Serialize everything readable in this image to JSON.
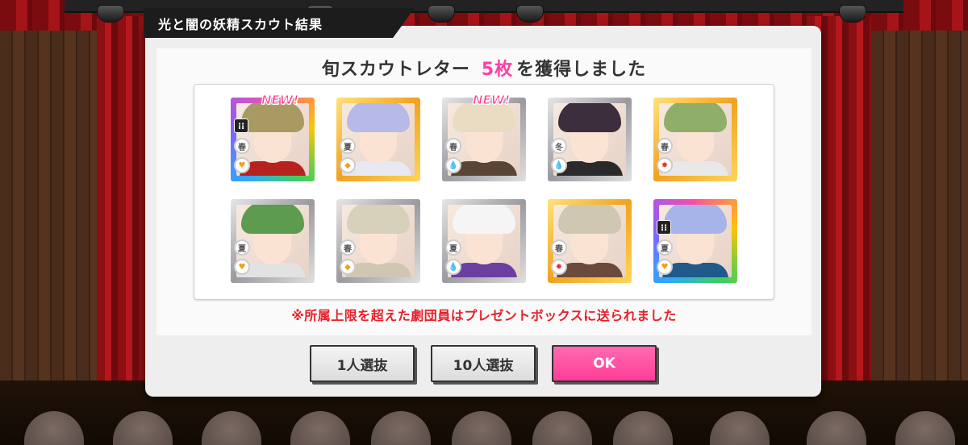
{
  "header": {
    "title": "光と闇の妖精スカウト結果"
  },
  "result": {
    "headline_pre": "旬スカウトレター",
    "count": "5枚",
    "headline_post": "を獲得しました",
    "accent": "#ff3da8"
  },
  "cards": [
    {
      "frame": "rainbow",
      "season": "春",
      "type": "♥",
      "rare": "⁝⁝",
      "new": "NEW!",
      "hair": "#a89a62",
      "body": "#b8221e"
    },
    {
      "frame": "gold",
      "season": "夏",
      "type": "◆",
      "rare": "",
      "new": "",
      "hair": "#b7b9e8",
      "body": "#e8e8f2"
    },
    {
      "frame": "silver",
      "season": "春",
      "type": "💧",
      "rare": "",
      "new": "NEW!",
      "hair": "#e9dcc2",
      "body": "#5a4436"
    },
    {
      "frame": "silver",
      "season": "冬",
      "type": "💧",
      "rare": "",
      "new": "",
      "hair": "#3c2e3c",
      "body": "#2a2a2a"
    },
    {
      "frame": "gold",
      "season": "春",
      "type": "✸",
      "rare": "",
      "new": "",
      "hair": "#8fae6a",
      "body": "#e8e8e8"
    },
    {
      "frame": "silver",
      "season": "夏",
      "type": "♥",
      "rare": "",
      "new": "",
      "hair": "#5d9b4f",
      "body": "#e2e2e2"
    },
    {
      "frame": "silver",
      "season": "春",
      "type": "◆",
      "rare": "",
      "new": "",
      "hair": "#d7d1bb",
      "body": "#cfc7b2"
    },
    {
      "frame": "silver",
      "season": "夏",
      "type": "💧",
      "rare": "",
      "new": "",
      "hair": "#f5f5f5",
      "body": "#6b3fa0"
    },
    {
      "frame": "gold",
      "season": "春",
      "type": "✸",
      "rare": "",
      "new": "",
      "hair": "#cfc7b2",
      "body": "#6a4a3a"
    },
    {
      "frame": "rainbow",
      "season": "夏",
      "type": "♥",
      "rare": "⁝⁝",
      "new": "",
      "hair": "#a7b4ea",
      "body": "#1f5a8a"
    }
  ],
  "notice": "※所属上限を超えた劇団員はプレゼントボックスに送られました",
  "buttons": {
    "select_one": "1人選抜",
    "select_ten": "10人選抜",
    "ok": "OK"
  }
}
